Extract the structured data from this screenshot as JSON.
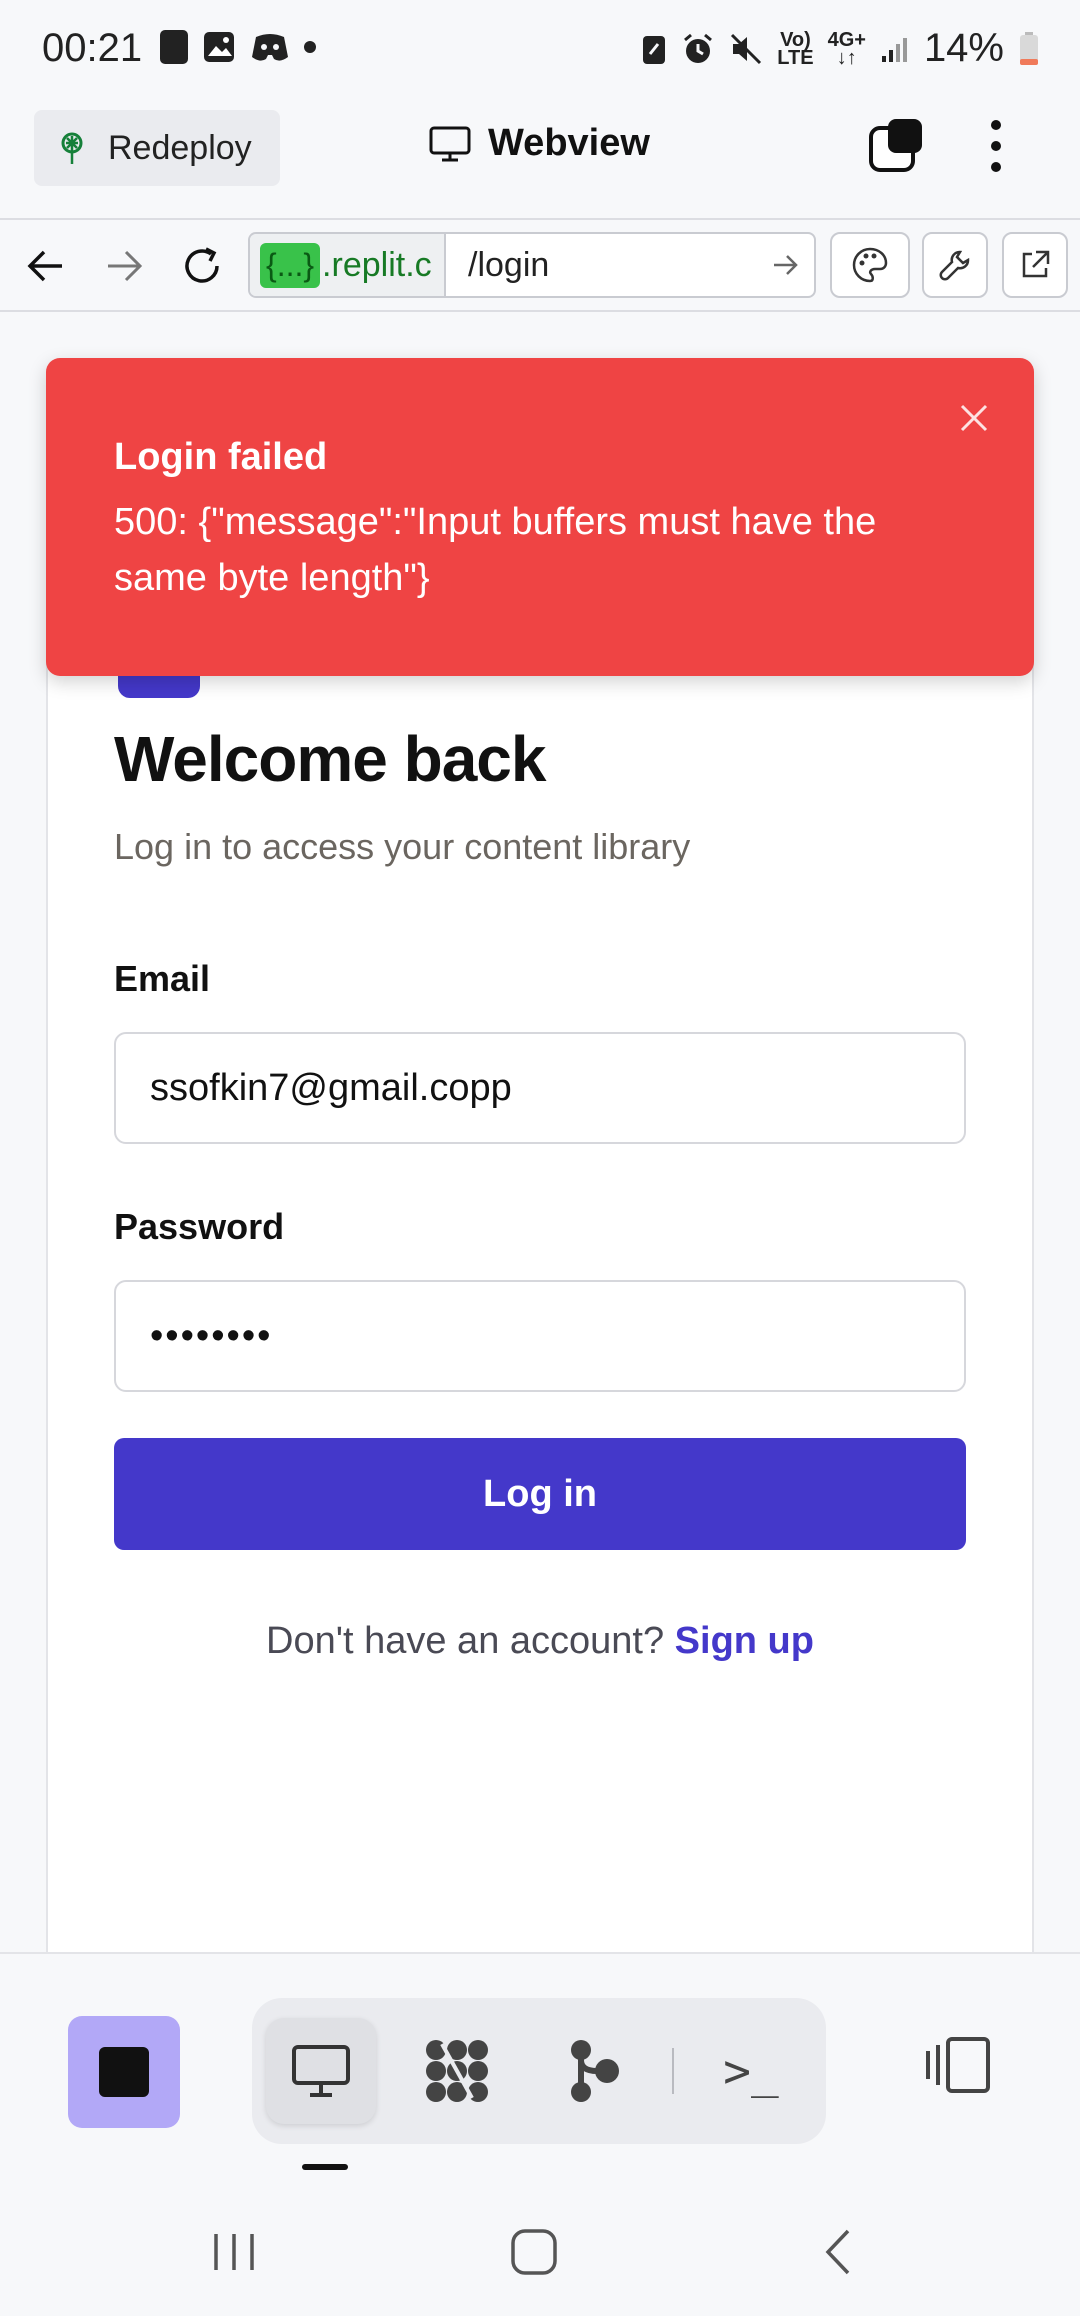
{
  "status_bar": {
    "time": "00:21",
    "network_top": "Vo)",
    "network_bottom": "LTE",
    "net2_top": "4G+",
    "battery": "14%"
  },
  "app_header": {
    "redeploy_label": "Redeploy",
    "title": "Webview"
  },
  "url_bar": {
    "host_badge": "{...}",
    "host_domain": ".replit.c",
    "path": "/login"
  },
  "toast": {
    "title": "Login failed",
    "message": "500: {\"message\":\"Input buffers must have the same byte length\"}"
  },
  "login_card": {
    "heading": "Welcome back",
    "subtitle": "Log in to access your content library",
    "email_label": "Email",
    "email_value": "ssofkin7@gmail.copp",
    "password_label": "Password",
    "password_value": "••••••••",
    "login_button": "Log in",
    "signup_prompt": "Don't have an account?",
    "signup_link": "Sign up"
  },
  "colors": {
    "accent": "#4438ca",
    "error": "#ef4444",
    "stop_button": "#b2a8f7"
  },
  "bottom_toolbar": {
    "terminal_glyph": ">_"
  }
}
